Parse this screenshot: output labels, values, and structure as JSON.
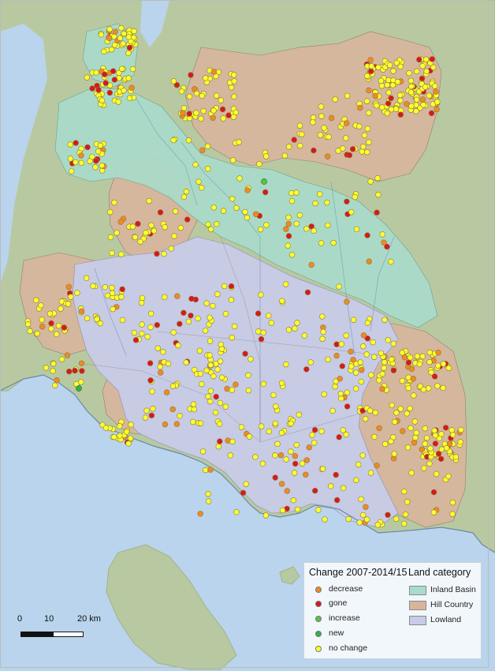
{
  "legend": {
    "change_title": "Change 2007-2014/15",
    "land_title": "Land category",
    "change_items": [
      {
        "label": "decrease",
        "color": "#f08a24"
      },
      {
        "label": "gone",
        "color": "#d7191c"
      },
      {
        "label": "increase",
        "color": "#5cc43a"
      },
      {
        "label": "new",
        "color": "#2fb34a"
      },
      {
        "label": "no change",
        "color": "#ffff2e"
      }
    ],
    "land_items": [
      {
        "label": "Inland Basin",
        "color": "#a9dccb"
      },
      {
        "label": "Hill Country",
        "color": "#d7b59c"
      },
      {
        "label": "Lowland",
        "color": "#c7cbe8"
      }
    ]
  },
  "scalebar": {
    "labels": [
      "0",
      "10",
      "20 km"
    ]
  },
  "map_colors": {
    "sea": "#b9d4ec",
    "terrain": "#b8c9a2",
    "inland_basin": "#a9dccb",
    "hill_country": "#d7b59c",
    "lowland": "#c7cbe8"
  }
}
